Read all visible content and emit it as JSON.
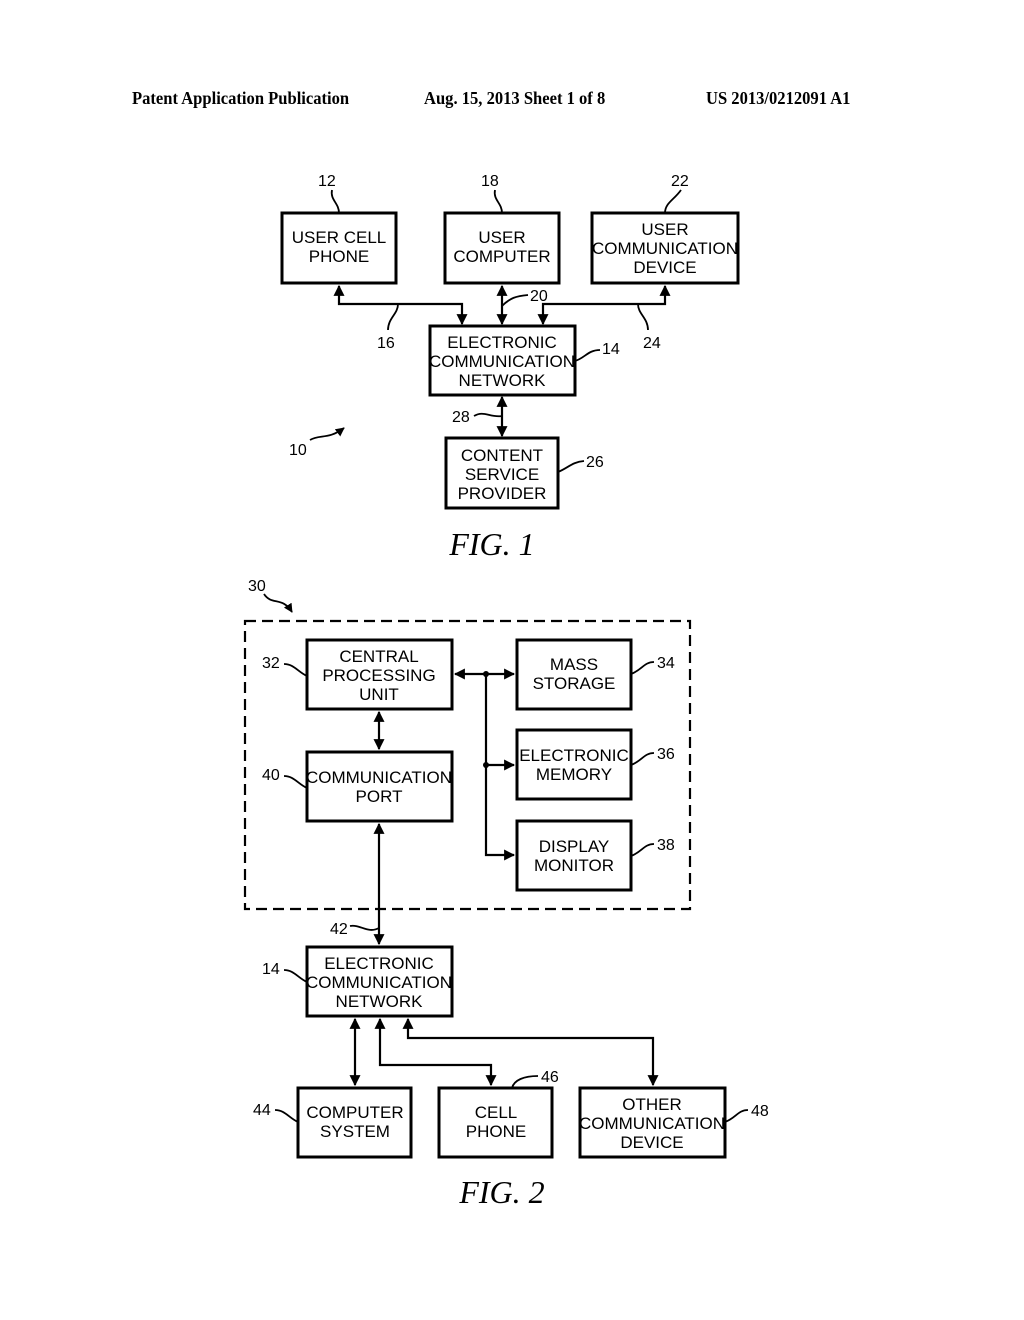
{
  "header": {
    "publication": "Patent Application Publication",
    "date_sheet": "Aug. 15, 2013  Sheet 1 of 8",
    "number": "US 2013/0212091 A1"
  },
  "fig1": {
    "caption": "FIG. 1",
    "system_ref": "10",
    "boxes": {
      "user_cell_phone": {
        "ref": "12",
        "lines": [
          "USER CELL",
          "PHONE"
        ]
      },
      "user_computer": {
        "ref": "18",
        "lines": [
          "USER",
          "COMPUTER"
        ]
      },
      "user_comm_device": {
        "ref": "22",
        "lines": [
          "USER",
          "COMMUNICATION",
          "DEVICE"
        ]
      },
      "network": {
        "ref": "14",
        "lines": [
          "ELECTRONIC",
          "COMMUNICATION",
          "NETWORK"
        ]
      },
      "content_provider": {
        "ref": "26",
        "lines": [
          "CONTENT",
          "SERVICE",
          "PROVIDER"
        ]
      }
    },
    "links": {
      "cell_link": "16",
      "computer_link": "20",
      "device_link": "24",
      "provider_link": "28"
    }
  },
  "fig2": {
    "caption": "FIG. 2",
    "system_ref": "30",
    "boxes": {
      "cpu": {
        "ref": "32",
        "lines": [
          "CENTRAL",
          "PROCESSING",
          "UNIT"
        ]
      },
      "mass_storage": {
        "ref": "34",
        "lines": [
          "MASS",
          "STORAGE"
        ]
      },
      "memory": {
        "ref": "36",
        "lines": [
          "ELECTRONIC",
          "MEMORY"
        ]
      },
      "display": {
        "ref": "38",
        "lines": [
          "DISPLAY",
          "MONITOR"
        ]
      },
      "comm_port": {
        "ref": "40",
        "lines": [
          "COMMUNICATION",
          "PORT"
        ]
      },
      "network": {
        "ref": "14",
        "lines": [
          "ELECTRONIC",
          "COMMUNICATION",
          "NETWORK"
        ]
      },
      "computer_system": {
        "ref": "44",
        "lines": [
          "COMPUTER",
          "SYSTEM"
        ]
      },
      "cell_phone": {
        "ref": "46",
        "lines": [
          "CELL",
          "PHONE"
        ]
      },
      "other_device": {
        "ref": "48",
        "lines": [
          "OTHER",
          "COMMUNICATION",
          "DEVICE"
        ]
      }
    },
    "links": {
      "port_link": "42"
    }
  }
}
